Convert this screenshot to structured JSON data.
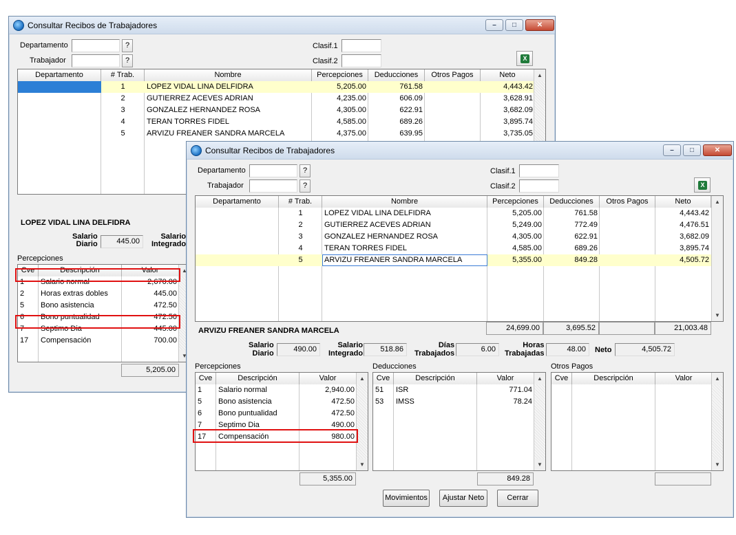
{
  "back": {
    "title": "Consultar Recibos de Trabajadores",
    "departamento_label": "Departamento",
    "trabajador_label": "Trabajador",
    "clasif1_label": "Clasif.1",
    "clasif2_label": "Clasif.2",
    "q": "?",
    "columns": [
      "Departamento",
      "# Trab.",
      "Nombre",
      "Percepciones",
      "Deducciones",
      "Otros Pagos",
      "Neto"
    ],
    "rows": [
      {
        "num": "1",
        "nombre": "LOPEZ VIDAL LINA DELFIDRA",
        "perc": "5,205.00",
        "ded": "761.58",
        "otros": "",
        "neto": "4,443.42"
      },
      {
        "num": "2",
        "nombre": "GUTIERREZ ACEVES ADRIAN",
        "perc": "4,235.00",
        "ded": "606.09",
        "otros": "",
        "neto": "3,628.91"
      },
      {
        "num": "3",
        "nombre": "GONZALEZ HERNANDEZ ROSA",
        "perc": "4,305.00",
        "ded": "622.91",
        "otros": "",
        "neto": "3,682.09"
      },
      {
        "num": "4",
        "nombre": "TERAN TORRES FIDEL",
        "perc": "4,585.00",
        "ded": "689.26",
        "otros": "",
        "neto": "3,895.74"
      },
      {
        "num": "5",
        "nombre": "ARVIZU FREANER SANDRA MARCELA",
        "perc": "4,375.00",
        "ded": "639.95",
        "otros": "",
        "neto": "3,735.05"
      }
    ],
    "employee_name": "LOPEZ VIDAL LINA DELFIDRA",
    "salario_diario_label1": "Salario",
    "salario_diario_label2": "Diario",
    "salario_diario": "445.00",
    "salario_integrado_label1": "Salario",
    "salario_integrado_label2": "Integrado",
    "percepciones_label": "Percepciones",
    "perc_columns": [
      "Cve",
      "Descripción",
      "Valor"
    ],
    "perc_rows": [
      {
        "cve": "1",
        "desc": "Salario normal",
        "valor": "2,670.00"
      },
      {
        "cve": "2",
        "desc": "Horas extras dobles",
        "valor": "445.00"
      },
      {
        "cve": "5",
        "desc": "Bono asistencia",
        "valor": "472.50"
      },
      {
        "cve": "6",
        "desc": "Bono puntualidad",
        "valor": "472.50"
      },
      {
        "cve": "7",
        "desc": "Septimo Dia",
        "valor": "445.00"
      },
      {
        "cve": "17",
        "desc": "Compensación",
        "valor": "700.00"
      }
    ],
    "perc_total": "5,205.00"
  },
  "front": {
    "title": "Consultar Recibos de Trabajadores",
    "departamento_label": "Departamento",
    "trabajador_label": "Trabajador",
    "clasif1_label": "Clasif.1",
    "clasif2_label": "Clasif.2",
    "q": "?",
    "columns": [
      "Departamento",
      "# Trab.",
      "Nombre",
      "Percepciones",
      "Deducciones",
      "Otros Pagos",
      "Neto"
    ],
    "rows": [
      {
        "num": "1",
        "nombre": "LOPEZ VIDAL LINA DELFIDRA",
        "perc": "5,205.00",
        "ded": "761.58",
        "otros": "",
        "neto": "4,443.42"
      },
      {
        "num": "2",
        "nombre": "GUTIERREZ ACEVES ADRIAN",
        "perc": "5,249.00",
        "ded": "772.49",
        "otros": "",
        "neto": "4,476.51"
      },
      {
        "num": "3",
        "nombre": "GONZALEZ HERNANDEZ ROSA",
        "perc": "4,305.00",
        "ded": "622.91",
        "otros": "",
        "neto": "3,682.09"
      },
      {
        "num": "4",
        "nombre": "TERAN TORRES FIDEL",
        "perc": "4,585.00",
        "ded": "689.26",
        "otros": "",
        "neto": "3,895.74"
      },
      {
        "num": "5",
        "nombre": "ARVIZU FREANER SANDRA MARCELA",
        "perc": "5,355.00",
        "ded": "849.28",
        "otros": "",
        "neto": "4,505.72"
      }
    ],
    "totals": {
      "perc": "24,699.00",
      "ded": "3,695.52",
      "otros": "",
      "neto": "21,003.48"
    },
    "employee_name": "ARVIZU FREANER SANDRA MARCELA",
    "salario_diario": {
      "l1": "Salario",
      "l2": "Diario",
      "value": "490.00"
    },
    "salario_integrado": {
      "l1": "Salario",
      "l2": "Integrado",
      "value": "518.86"
    },
    "dias_trabajados": {
      "l1": "Días",
      "l2": "Trabajados",
      "value": "6.00"
    },
    "horas_trabajadas": {
      "l1": "Horas",
      "l2": "Trabajadas",
      "value": "48.00"
    },
    "neto": {
      "label": "Neto",
      "value": "4,505.72"
    },
    "percepciones": {
      "label": "Percepciones",
      "columns": [
        "Cve",
        "Descripción",
        "Valor"
      ],
      "rows": [
        {
          "cve": "1",
          "desc": "Salario normal",
          "valor": "2,940.00"
        },
        {
          "cve": "5",
          "desc": "Bono asistencia",
          "valor": "472.50"
        },
        {
          "cve": "6",
          "desc": "Bono puntualidad",
          "valor": "472.50"
        },
        {
          "cve": "7",
          "desc": "Septimo Dia",
          "valor": "490.00"
        },
        {
          "cve": "17",
          "desc": "Compensación",
          "valor": "980.00"
        }
      ],
      "total": "5,355.00"
    },
    "deducciones": {
      "label": "Deducciones",
      "columns": [
        "Cve",
        "Descripción",
        "Valor"
      ],
      "rows": [
        {
          "cve": "51",
          "desc": "ISR",
          "valor": "771.04"
        },
        {
          "cve": "53",
          "desc": "IMSS",
          "valor": "78.24"
        }
      ],
      "total": "849.28"
    },
    "otros_pagos": {
      "label": "Otros Pagos",
      "columns": [
        "Cve",
        "Descripción",
        "Valor"
      ],
      "total": ""
    },
    "buttons": {
      "movimientos": "Movimientos",
      "ajustar_neto": "Ajustar Neto",
      "cerrar": "Cerrar"
    }
  },
  "icons": {
    "window_icon": "app-globe-icon",
    "excel": "excel-export-icon"
  }
}
